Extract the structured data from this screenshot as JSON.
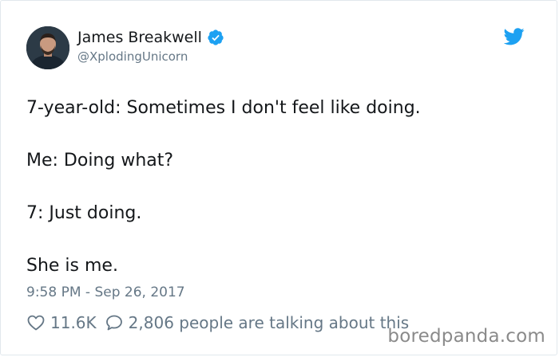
{
  "author": {
    "display_name": "James Breakwell",
    "handle": "@XplodingUnicorn",
    "verified": true,
    "avatar_icon": "profile-photo"
  },
  "tweet": {
    "lines": [
      "7-year-old: Sometimes I don't feel like doing.",
      "Me: Doing what?",
      "7: Just doing.",
      "She is me."
    ],
    "timestamp": "9:58 PM - Sep 26, 2017"
  },
  "engagement": {
    "likes": "11.6K",
    "talking": "2,806 people are talking about this"
  },
  "icons": {
    "verified": "verified-badge-icon",
    "bird": "twitter-bird-icon",
    "heart": "heart-icon",
    "reply": "reply-bubble-icon"
  },
  "colors": {
    "accent": "#1da1f2",
    "text": "#14171a",
    "muted": "#657786",
    "watermark": "#8a8a8a"
  },
  "watermark": "boredpanda.com"
}
